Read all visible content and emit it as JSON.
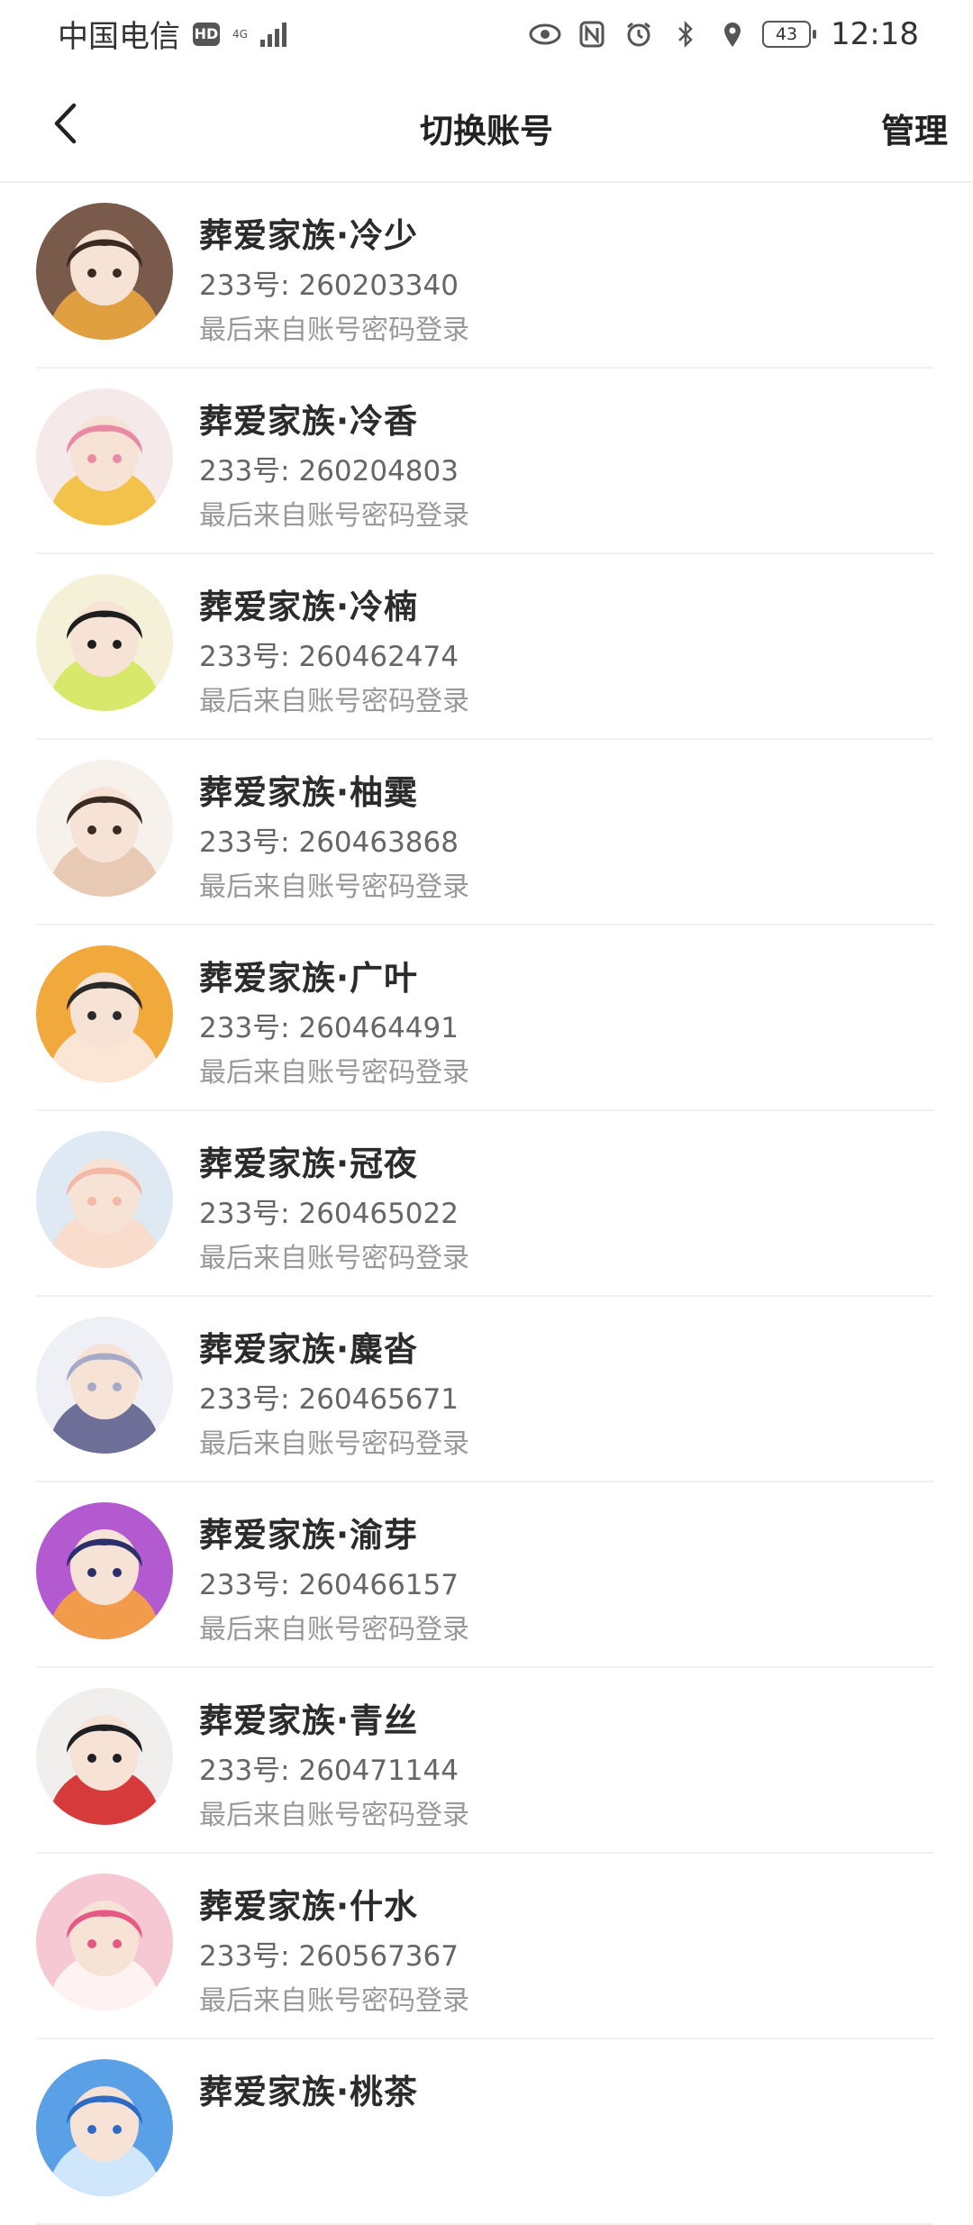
{
  "status_bar": {
    "carrier": "中国电信",
    "hd": "HD",
    "network": "4G",
    "battery": "43",
    "time": "12:18"
  },
  "header": {
    "title": "切换账号",
    "manage_label": "管理",
    "back_icon": "chevron-left-icon"
  },
  "accounts": [
    {
      "name": "葬爱家族·冷少",
      "uid": "233号: 260203340",
      "login": "最后来自账号密码登录",
      "avatar_colors": [
        "#7a5a4a",
        "#3b2a24",
        "#e0a040"
      ]
    },
    {
      "name": "葬爱家族·冷香",
      "uid": "233号: 260204803",
      "login": "最后来自账号密码登录",
      "avatar_colors": [
        "#f6e9ea",
        "#e88aa5",
        "#f2c24a"
      ]
    },
    {
      "name": "葬爱家族·冷楠",
      "uid": "233号: 260462474",
      "login": "最后来自账号密码登录",
      "avatar_colors": [
        "#f5f1d8",
        "#1e1e1e",
        "#d8e86a"
      ]
    },
    {
      "name": "葬爱家族·柚霙",
      "uid": "233号: 260463868",
      "login": "最后来自账号密码登录",
      "avatar_colors": [
        "#f7f1ec",
        "#3a2a22",
        "#e7c9b4"
      ]
    },
    {
      "name": "葬爱家族·广叶",
      "uid": "233号: 260464491",
      "login": "最后来自账号密码登录",
      "avatar_colors": [
        "#f2a93b",
        "#2a2a2a",
        "#fbe5d4"
      ]
    },
    {
      "name": "葬爱家族·冠夜",
      "uid": "233号: 260465022",
      "login": "最后来自账号密码登录",
      "avatar_colors": [
        "#dfe9f3",
        "#f4b8a6",
        "#f9dccb"
      ]
    },
    {
      "name": "葬爱家族·麋沓",
      "uid": "233号: 260465671",
      "login": "最后来自账号密码登录",
      "avatar_colors": [
        "#eef0f6",
        "#a7a9c9",
        "#6d6f98"
      ]
    },
    {
      "name": "葬爱家族·渝芽",
      "uid": "233号: 260466157",
      "login": "最后来自账号密码登录",
      "avatar_colors": [
        "#b45ad0",
        "#2b2f6a",
        "#f29b4a"
      ]
    },
    {
      "name": "葬爱家族·青丝",
      "uid": "233号: 260471144",
      "login": "最后来自账号密码登录",
      "avatar_colors": [
        "#f1eeee",
        "#1f2024",
        "#d63a3a"
      ]
    },
    {
      "name": "葬爱家族·什水",
      "uid": "233号: 260567367",
      "login": "最后来自账号密码登录",
      "avatar_colors": [
        "#f6c8d3",
        "#e55a84",
        "#fff2f2"
      ]
    },
    {
      "name": "葬爱家族·桃茶",
      "uid": "",
      "login": "",
      "avatar_colors": [
        "#5aa0e6",
        "#2d6bc4",
        "#cfe6fb"
      ]
    }
  ]
}
